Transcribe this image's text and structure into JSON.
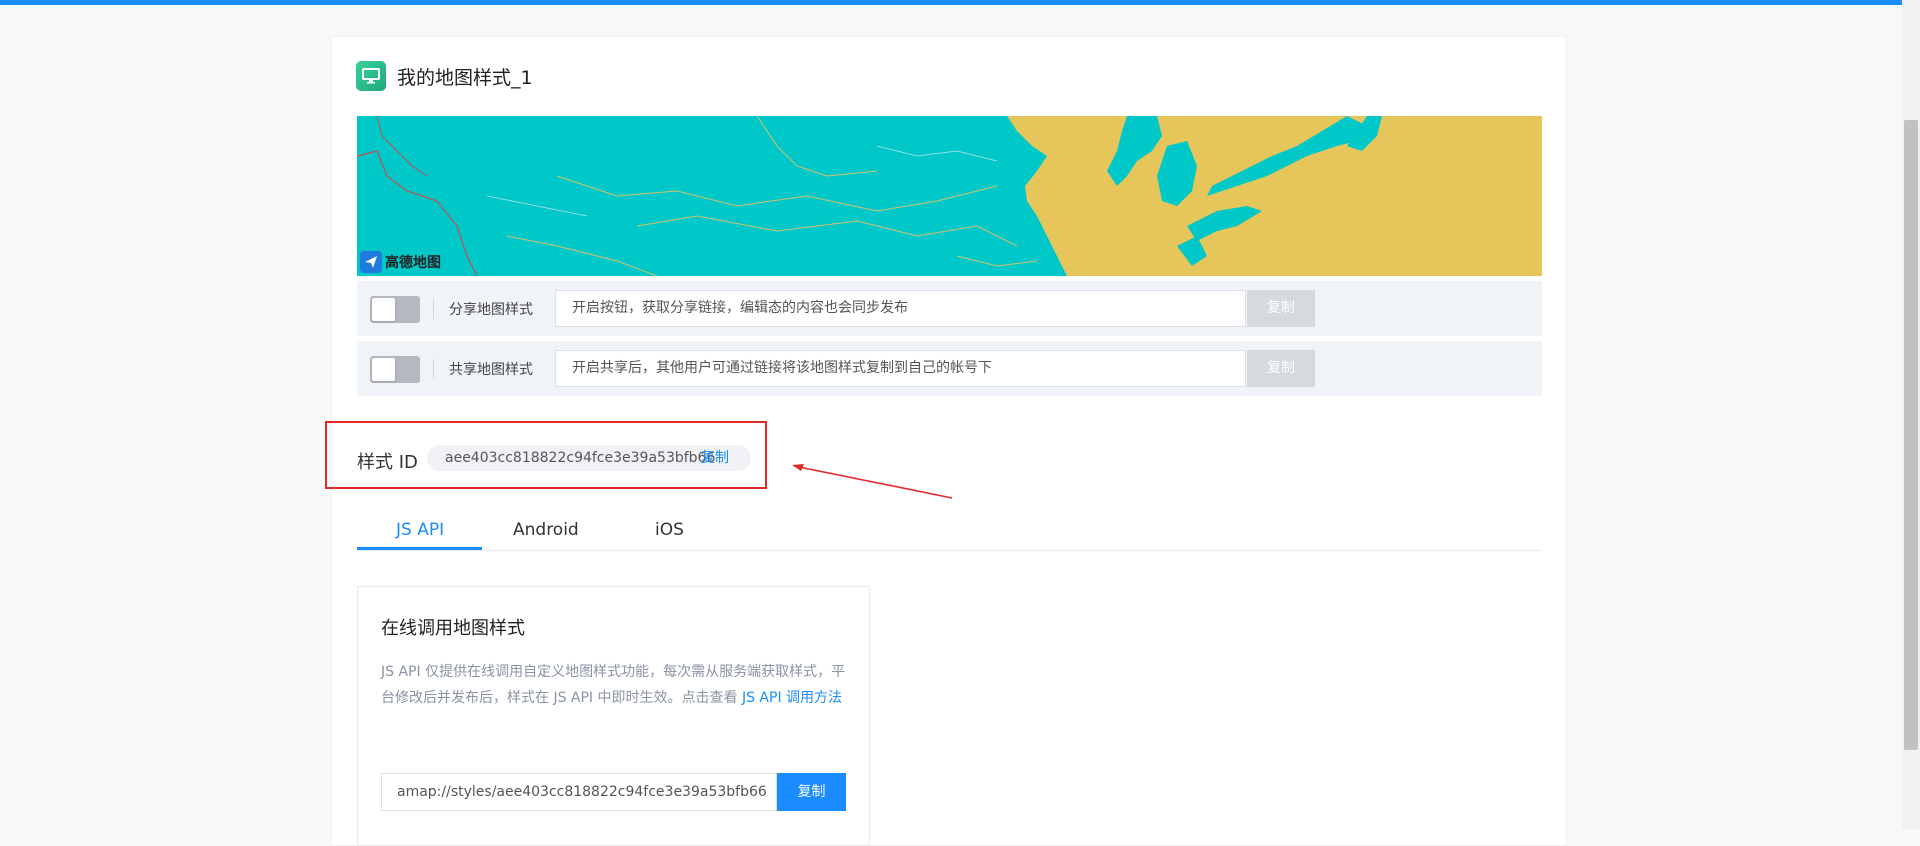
{
  "title": "我的地图样式_1",
  "map_logo": "高德地图",
  "share": {
    "label": "分享地图样式",
    "placeholder": "开启按钮，获取分享链接，编辑态的内容也会同步发布",
    "copy_label": "复制",
    "enabled": false
  },
  "shared": {
    "label": "共享地图样式",
    "placeholder": "开启共享后，其他用户可通过链接将该地图样式复制到自己的帐号下",
    "copy_label": "复制",
    "enabled": false
  },
  "style_id": {
    "label": "样式 ID",
    "value": "aee403cc818822c94fce3e39a53bfb66",
    "copy_label": "复制"
  },
  "tabs": [
    {
      "label": "JS API",
      "active": true
    },
    {
      "label": "Android",
      "active": false
    },
    {
      "label": "iOS",
      "active": false
    }
  ],
  "api_card": {
    "title": "在线调用地图样式",
    "desc_text": "JS API 仅提供在线调用自定义地图样式功能，每次需从服务端获取样式，平台修改后并发布后，样式在 JS API 中即时生效。点击查看 ",
    "desc_link": "JS API 调用方法",
    "url_value": "amap://styles/aee403cc818822c94fce3e39a53bfb66",
    "copy_label": "复制"
  },
  "colors": {
    "accent": "#1a8cff",
    "map_water": "#00c8c8",
    "map_land": "#e6c65a",
    "highlight_box": "#e02a2a"
  }
}
